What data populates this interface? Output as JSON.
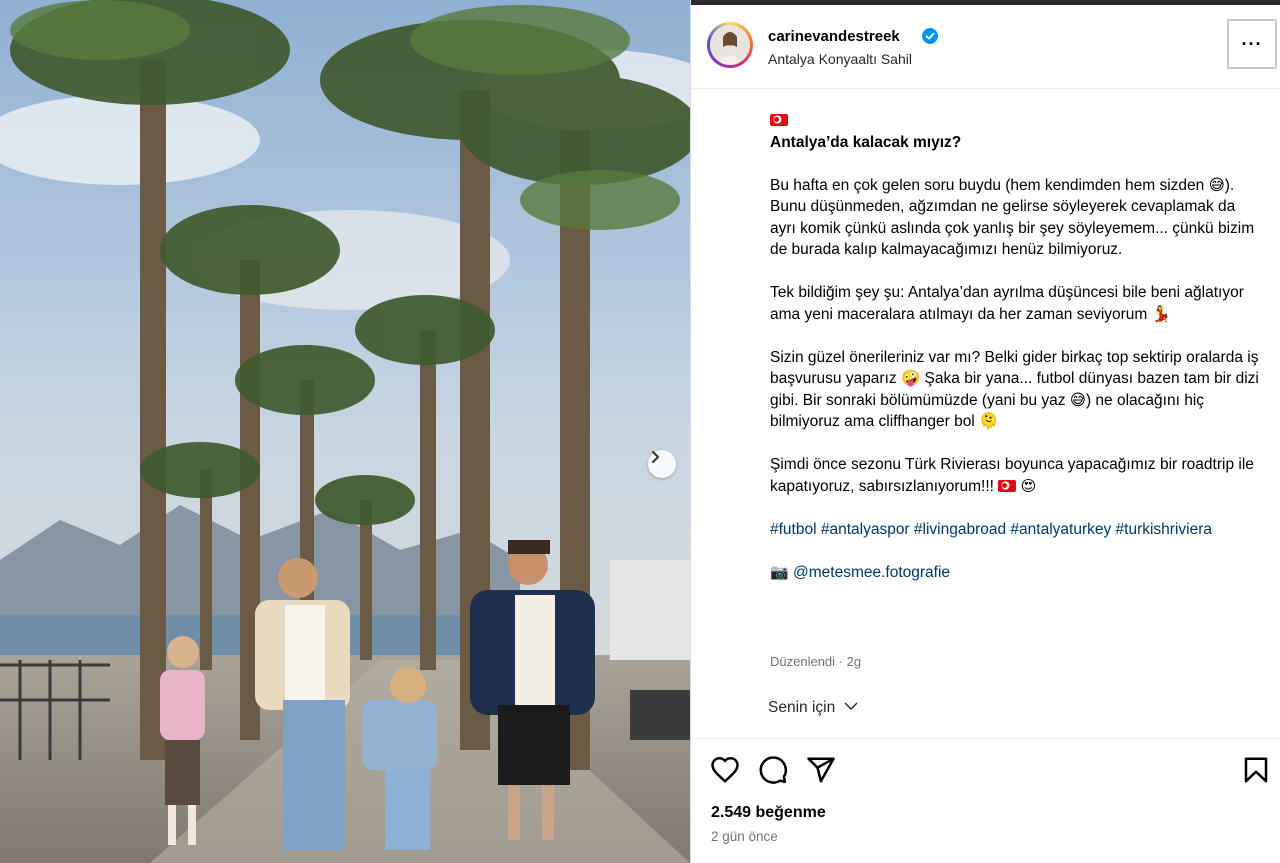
{
  "post": {
    "username": "carinevandestreek",
    "location": "Antalya Konyaaltı Sahil",
    "more_label": "···"
  },
  "caption": {
    "title": "Antalya’da kalacak mıyız?",
    "p1": "Bu hafta en çok gelen soru buydu (hem kendimden hem sizden 😅). Bunu düşünmeden, ağzımdan ne gelirse söyleyerek cevaplamak da ayrı komik çünkü aslında çok yanlış bir şey söyleyemem... çünkü bizim de burada kalıp kalmayacağımızı henüz bilmiyoruz.",
    "p2": "Tek bildiğim şey şu: Antalya’dan ayrılma düşüncesi bile beni ağlatıyor ama yeni maceralara atılmayı da her zaman seviyorum 💃",
    "p3": "Sizin güzel önerileriniz var mı? Belki gider birkaç top sektirip oralarda iş başvurusu yaparız 🤪 Şaka bir yana... futbol dünyası bazen tam bir dizi gibi. Bir sonraki bölümümüzde (yani bu yaz 😅) ne olacağını hiç bilmiyoruz ama cliffhanger bol 🫠",
    "p4_text": "Şimdi önce sezonu Türk Rivierası boyunca yapacağımız bir roadtrip ile kapatıyoruz, sabırsızlanıyorum!!!",
    "p4_emoji": "😍",
    "hashtags": "#futbol #antalyaspor #livingabroad #antalyaturkey #turkishriviera",
    "camera_emoji": "📷",
    "credit": "@metesmee.fotografie",
    "edited": "Düzenlendi · 2g"
  },
  "for_you": {
    "label": "Senin için"
  },
  "stats": {
    "likes": "2.549 beğenme",
    "age": "2 gün önce"
  },
  "colors": {
    "link": "#00376b",
    "muted": "#737373",
    "verified": "#0095f6"
  }
}
